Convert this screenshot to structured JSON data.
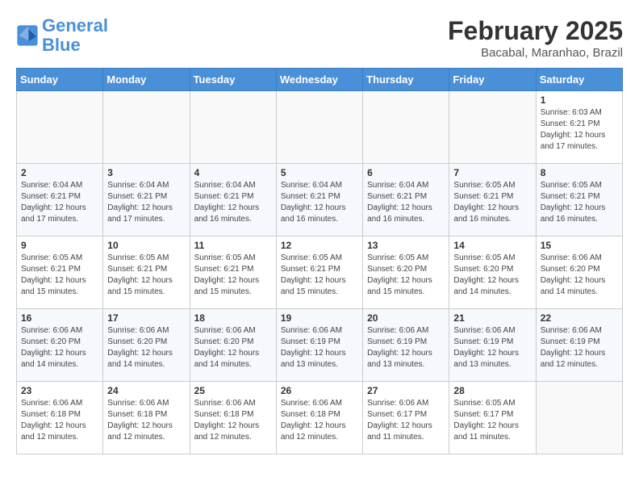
{
  "header": {
    "logo_general": "General",
    "logo_blue": "Blue",
    "month_title": "February 2025",
    "location": "Bacabal, Maranhao, Brazil"
  },
  "days_of_week": [
    "Sunday",
    "Monday",
    "Tuesday",
    "Wednesday",
    "Thursday",
    "Friday",
    "Saturday"
  ],
  "weeks": [
    [
      {
        "day": "",
        "text": ""
      },
      {
        "day": "",
        "text": ""
      },
      {
        "day": "",
        "text": ""
      },
      {
        "day": "",
        "text": ""
      },
      {
        "day": "",
        "text": ""
      },
      {
        "day": "",
        "text": ""
      },
      {
        "day": "1",
        "text": "Sunrise: 6:03 AM\nSunset: 6:21 PM\nDaylight: 12 hours\nand 17 minutes."
      }
    ],
    [
      {
        "day": "2",
        "text": "Sunrise: 6:04 AM\nSunset: 6:21 PM\nDaylight: 12 hours\nand 17 minutes."
      },
      {
        "day": "3",
        "text": "Sunrise: 6:04 AM\nSunset: 6:21 PM\nDaylight: 12 hours\nand 17 minutes."
      },
      {
        "day": "4",
        "text": "Sunrise: 6:04 AM\nSunset: 6:21 PM\nDaylight: 12 hours\nand 16 minutes."
      },
      {
        "day": "5",
        "text": "Sunrise: 6:04 AM\nSunset: 6:21 PM\nDaylight: 12 hours\nand 16 minutes."
      },
      {
        "day": "6",
        "text": "Sunrise: 6:04 AM\nSunset: 6:21 PM\nDaylight: 12 hours\nand 16 minutes."
      },
      {
        "day": "7",
        "text": "Sunrise: 6:05 AM\nSunset: 6:21 PM\nDaylight: 12 hours\nand 16 minutes."
      },
      {
        "day": "8",
        "text": "Sunrise: 6:05 AM\nSunset: 6:21 PM\nDaylight: 12 hours\nand 16 minutes."
      }
    ],
    [
      {
        "day": "9",
        "text": "Sunrise: 6:05 AM\nSunset: 6:21 PM\nDaylight: 12 hours\nand 15 minutes."
      },
      {
        "day": "10",
        "text": "Sunrise: 6:05 AM\nSunset: 6:21 PM\nDaylight: 12 hours\nand 15 minutes."
      },
      {
        "day": "11",
        "text": "Sunrise: 6:05 AM\nSunset: 6:21 PM\nDaylight: 12 hours\nand 15 minutes."
      },
      {
        "day": "12",
        "text": "Sunrise: 6:05 AM\nSunset: 6:21 PM\nDaylight: 12 hours\nand 15 minutes."
      },
      {
        "day": "13",
        "text": "Sunrise: 6:05 AM\nSunset: 6:20 PM\nDaylight: 12 hours\nand 15 minutes."
      },
      {
        "day": "14",
        "text": "Sunrise: 6:05 AM\nSunset: 6:20 PM\nDaylight: 12 hours\nand 14 minutes."
      },
      {
        "day": "15",
        "text": "Sunrise: 6:06 AM\nSunset: 6:20 PM\nDaylight: 12 hours\nand 14 minutes."
      }
    ],
    [
      {
        "day": "16",
        "text": "Sunrise: 6:06 AM\nSunset: 6:20 PM\nDaylight: 12 hours\nand 14 minutes."
      },
      {
        "day": "17",
        "text": "Sunrise: 6:06 AM\nSunset: 6:20 PM\nDaylight: 12 hours\nand 14 minutes."
      },
      {
        "day": "18",
        "text": "Sunrise: 6:06 AM\nSunset: 6:20 PM\nDaylight: 12 hours\nand 14 minutes."
      },
      {
        "day": "19",
        "text": "Sunrise: 6:06 AM\nSunset: 6:19 PM\nDaylight: 12 hours\nand 13 minutes."
      },
      {
        "day": "20",
        "text": "Sunrise: 6:06 AM\nSunset: 6:19 PM\nDaylight: 12 hours\nand 13 minutes."
      },
      {
        "day": "21",
        "text": "Sunrise: 6:06 AM\nSunset: 6:19 PM\nDaylight: 12 hours\nand 13 minutes."
      },
      {
        "day": "22",
        "text": "Sunrise: 6:06 AM\nSunset: 6:19 PM\nDaylight: 12 hours\nand 12 minutes."
      }
    ],
    [
      {
        "day": "23",
        "text": "Sunrise: 6:06 AM\nSunset: 6:18 PM\nDaylight: 12 hours\nand 12 minutes."
      },
      {
        "day": "24",
        "text": "Sunrise: 6:06 AM\nSunset: 6:18 PM\nDaylight: 12 hours\nand 12 minutes."
      },
      {
        "day": "25",
        "text": "Sunrise: 6:06 AM\nSunset: 6:18 PM\nDaylight: 12 hours\nand 12 minutes."
      },
      {
        "day": "26",
        "text": "Sunrise: 6:06 AM\nSunset: 6:18 PM\nDaylight: 12 hours\nand 12 minutes."
      },
      {
        "day": "27",
        "text": "Sunrise: 6:06 AM\nSunset: 6:17 PM\nDaylight: 12 hours\nand 11 minutes."
      },
      {
        "day": "28",
        "text": "Sunrise: 6:05 AM\nSunset: 6:17 PM\nDaylight: 12 hours\nand 11 minutes."
      },
      {
        "day": "",
        "text": ""
      }
    ]
  ]
}
